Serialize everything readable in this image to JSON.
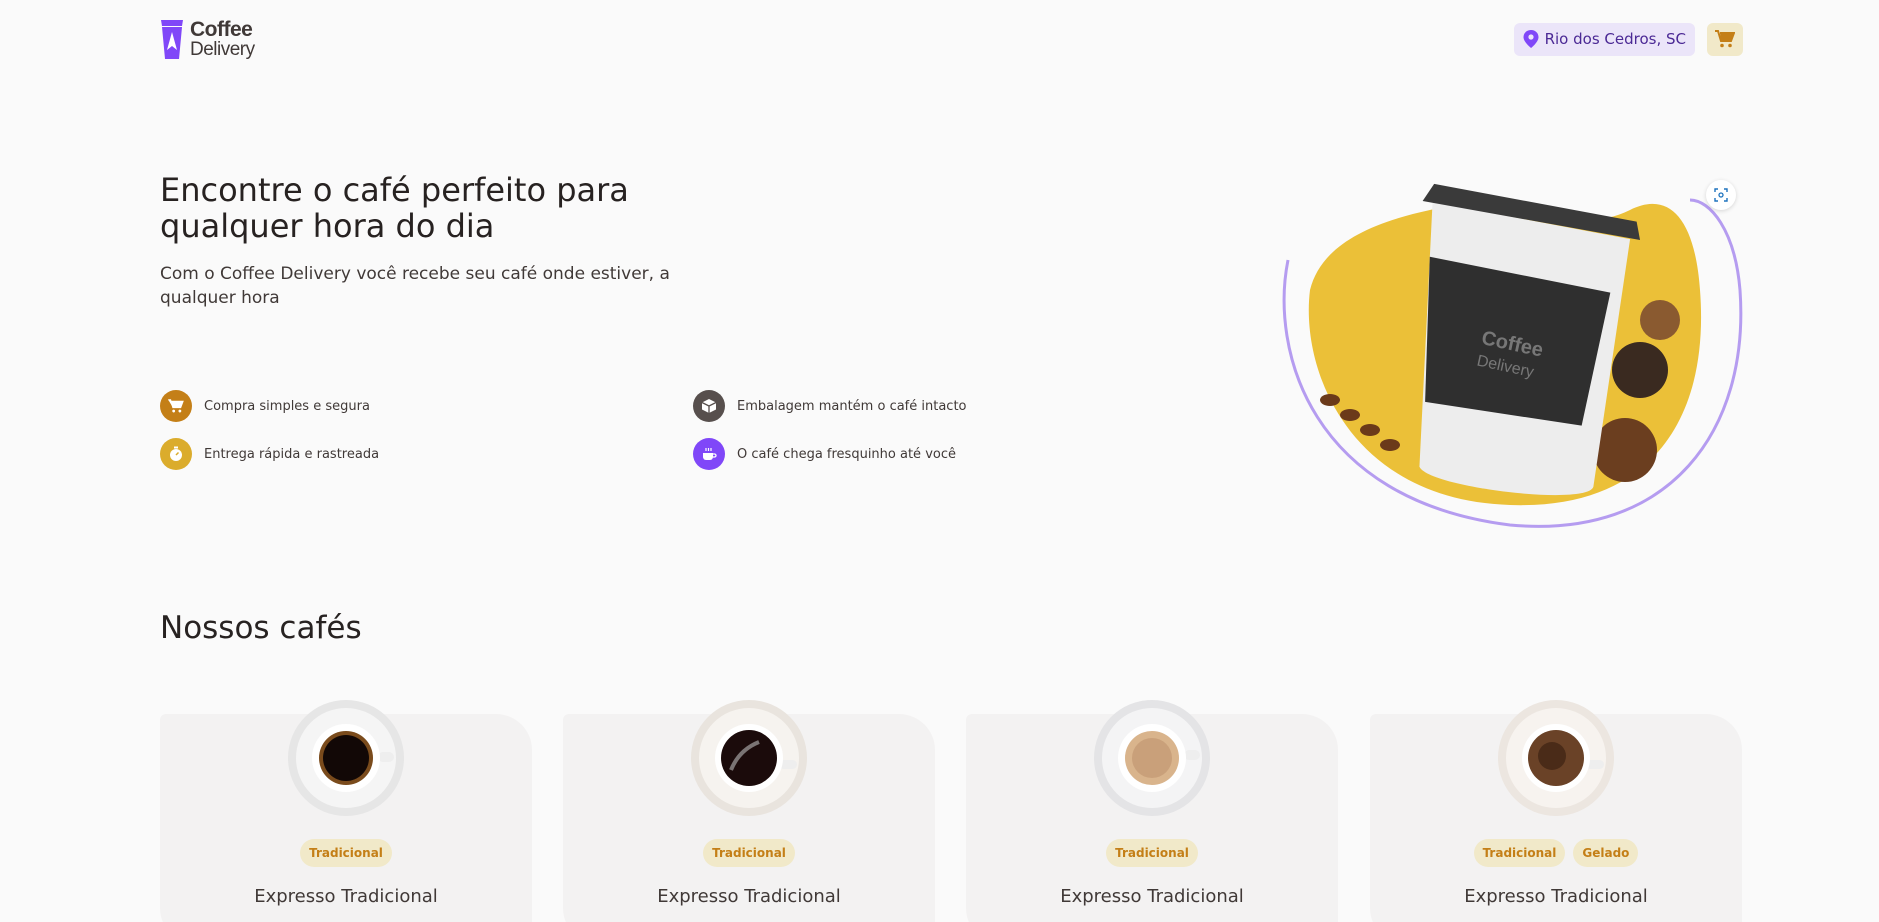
{
  "header": {
    "logo": {
      "line1": "Coffee",
      "line2": "Delivery"
    },
    "location": "Rio dos Cedros, SC",
    "icons": {
      "location": "map-pin-icon",
      "cart": "shopping-cart-icon"
    }
  },
  "hero": {
    "title": "Encontre o café perfeito para qualquer hora do dia",
    "subtitle": "Com o Coffee Delivery você recebe seu café onde estiver, a qualquer hora",
    "features": [
      {
        "label": "Compra simples e segura",
        "icon": "shopping-cart-icon",
        "color": "#C47F17"
      },
      {
        "label": "Embalagem mantém o café intacto",
        "icon": "package-icon",
        "color": "#574F4D"
      },
      {
        "label": "Entrega rápida e rastreada",
        "icon": "timer-icon",
        "color": "#DBAC2C"
      },
      {
        "label": "O café chega fresquinho até você",
        "icon": "coffee-icon",
        "color": "#8047F8"
      }
    ],
    "image_cup_logo": {
      "line1": "Coffee",
      "line2": "Delivery"
    }
  },
  "section": {
    "title": "Nossos cafés"
  },
  "products": [
    {
      "name": "Expresso Tradicional",
      "tags": [
        "Tradicional"
      ]
    },
    {
      "name": "Expresso Tradicional",
      "tags": [
        "Tradicional"
      ]
    },
    {
      "name": "Expresso Tradicional",
      "tags": [
        "Tradicional"
      ]
    },
    {
      "name": "Expresso Tradicional",
      "tags": [
        "Tradicional",
        "Gelado"
      ]
    }
  ],
  "colors": {
    "yellow_dark": "#C47F17",
    "yellow": "#DBAC2C",
    "yellow_light": "#F1E9C9",
    "purple_dark": "#4B2995",
    "purple": "#8047F8",
    "purple_light": "#EBE5F9",
    "background": "#FAFAFA",
    "card": "#F3F2F2"
  }
}
